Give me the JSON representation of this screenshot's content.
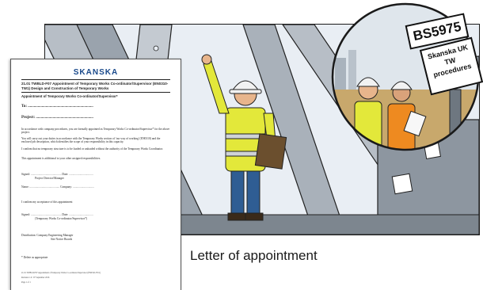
{
  "caption": "Letter of appointment",
  "zoom_callout": {
    "standard_tag": "BS5975",
    "procedures_tag": [
      "Skanska UK",
      "TW",
      "procedures"
    ]
  },
  "letter": {
    "logo": "SKANSKA",
    "heading": "21.01 TWBLD-F07 Appointment of Temporary Works Co-ordinator/Supervisor (EN0310-TW1) Design and Construction of Temporary Works",
    "subheading": "Appointment of Temporary Works Co-ordinator/Supervisor*",
    "to_field": "To: ..................................................................",
    "project_field": "Project: ..........................................................",
    "paragraphs": [
      "In accordance with company procedures, you are formally appointed as Temporary Works Co-ordinator/Supervisor* for the above project.",
      "You will carry out your duties in accordance with the Temporary Works section of 'our way of working' (EN0310) and the enclosed job description, which identifies the scope of your responsibility in this capacity.",
      "I confirm that no temporary structure is to be loaded or unloaded without the authority of the Temporary Works Coordinator.",
      "This appointment is additional to your other assigned responsibilities."
    ],
    "signed_1": "Signed: ...........................................     Date: ..................................",
    "signed_1_role": "Project Director/Manager",
    "name_company": "Name: ..........................................     Company: ..............................",
    "confirm_line": "I confirm my acceptance of this appointment",
    "signed_2": "Signed: ...........................................     Date: ..................................",
    "signed_2_role": "(Temporary Works Co-ordinator/Supervisor*)",
    "distribution": "Distribution:     Company Engineering Manager",
    "distribution_2": "Site Notice Boards",
    "delete_note": "* Delete as appropriate",
    "footer_1": "21.01 TWBLD-F07 Appointment of Temporary Works Co-ordinator/Supervisor (EN0310-TW1)",
    "footer_2": "Revision 1.0 / 07 September 2016",
    "footer_3": "Page 1 of 1"
  },
  "colors": {
    "sky": "#e9eef4",
    "steel": "#9aa3ad",
    "hi_vis_yellow": "#e3e83a",
    "hi_vis_orange": "#ee8a20",
    "trousers": "#2f5d93",
    "logo_blue": "#1a4a8c"
  }
}
